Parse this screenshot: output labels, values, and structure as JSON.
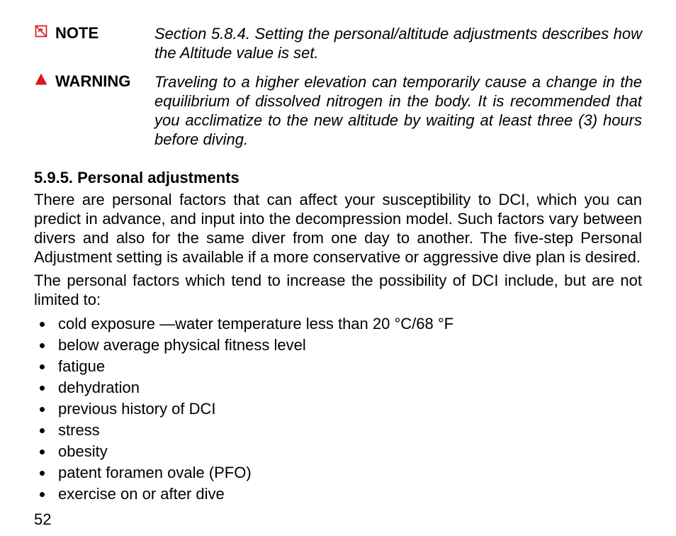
{
  "note": {
    "label": "NOTE",
    "body": "Section 5.8.4. Setting the personal/altitude adjustments describes how the Altitude value is set."
  },
  "warning": {
    "label": "WARNING",
    "body": "Traveling to a higher elevation can temporarily cause a change in the equilibrium of dissolved nitrogen in the body. It is recommended that you acclimatize to the new altitude by waiting at least three (3) hours before diving."
  },
  "section": {
    "title": "5.9.5. Personal adjustments",
    "para1": "There are personal factors that can affect your susceptibility to DCI, which you can predict in advance, and input into the decompression model. Such factors vary between divers and also for the same diver from one day to another. The five-step Personal Adjustment setting is available if a more conservative or aggressive dive plan is desired.",
    "para2": "The personal factors which tend to increase the possibility of DCI include, but are not limited to:",
    "factors": [
      "cold exposure —water temperature less than 20 °C/68 °F",
      "below average physical fitness level",
      "fatigue",
      "dehydration",
      "previous history of DCI",
      "stress",
      "obesity",
      "patent foramen ovale (PFO)",
      "exercise on or after dive"
    ]
  },
  "page_number": "52"
}
